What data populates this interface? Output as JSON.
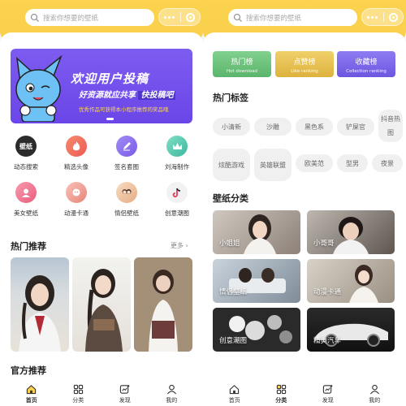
{
  "search": {
    "placeholder": "搜索你想要的壁纸"
  },
  "banner": {
    "title": "欢迎用户投稿",
    "slogan_left": "好资源就应共享",
    "slogan_right": "快投稿吧",
    "note": "优秀作品可获得本小程序推荐的奖品哦"
  },
  "grid": [
    {
      "label": "动态搜索",
      "badge": "壁纸",
      "color": "#2b2b2b",
      "icon": "wallpaper-logo-icon"
    },
    {
      "label": "精选头像",
      "color": "#f2695b",
      "icon": "flame-icon"
    },
    {
      "label": "签名套图",
      "color": "#8b6cf0",
      "icon": "pen-icon"
    },
    {
      "label": "刘海制作",
      "color": "#4fc7b0",
      "icon": "crown-icon"
    },
    {
      "label": "美女壁纸",
      "color": "#f27a8e",
      "icon": "portrait-icon"
    },
    {
      "label": "动漫卡通",
      "color": "#f1a9a0",
      "icon": "anime-icon"
    },
    {
      "label": "情侣壁纸",
      "color": "#f0c7a0",
      "icon": "couple-icon"
    },
    {
      "label": "创意潮图",
      "color": "#f2f2f2",
      "icon": "tiktok-icon"
    }
  ],
  "hot": {
    "title": "热门推荐",
    "more": "更多"
  },
  "official": {
    "title": "官方推荐"
  },
  "tabs": [
    {
      "label": "首页",
      "icon": "home-icon",
      "active": true
    },
    {
      "label": "分类",
      "icon": "grid-icon",
      "active": false
    },
    {
      "label": "发现",
      "icon": "discover-icon",
      "active": false
    },
    {
      "label": "我的",
      "icon": "user-icon",
      "active": false
    }
  ],
  "right": {
    "ranks": [
      {
        "title": "热门榜",
        "sub": "Hot download",
        "color": "#6ac27a"
      },
      {
        "title": "点赞榜",
        "sub": "Like ranking",
        "color": "#e8c04f"
      },
      {
        "title": "收藏榜",
        "sub": "Collection ranking",
        "color": "#7a66e8"
      }
    ],
    "tags_title": "热门标签",
    "tags_row1": [
      "小清新",
      "沙雕",
      "黑色系",
      "铲屎官",
      "抖音热图"
    ],
    "tags_row2": [
      "炫酷游戏",
      "英雄联盟",
      "欧美范",
      "型男",
      "夜景"
    ],
    "cat_title": "壁纸分类",
    "categories": [
      "小姐姐",
      "小哥哥",
      "情侣壁纸",
      "动漫卡通",
      "创意潮图",
      "精美汽车"
    ]
  }
}
